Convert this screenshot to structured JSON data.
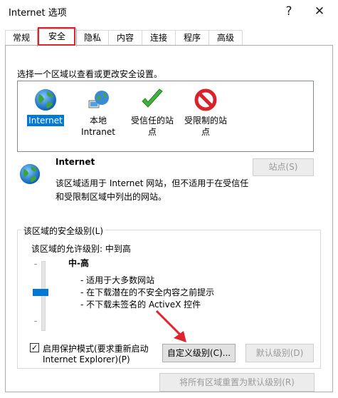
{
  "window": {
    "title": "Internet 选项",
    "help_glyph": "?",
    "close_glyph": "✕"
  },
  "tabs": [
    {
      "label": "常规"
    },
    {
      "label": "安全"
    },
    {
      "label": "隐私"
    },
    {
      "label": "内容"
    },
    {
      "label": "连接"
    },
    {
      "label": "程序"
    },
    {
      "label": "高级"
    }
  ],
  "active_tab": "安全",
  "instruction": "选择一个区域以查看或更改安全设置。",
  "zones": [
    {
      "label": "Internet",
      "icon": "globe-icon",
      "selected": true
    },
    {
      "label_lines": [
        "本地",
        "Intranet"
      ],
      "icon": "intranet-icon"
    },
    {
      "label_lines": [
        "受信任的站",
        "点"
      ],
      "icon": "checkmark-icon"
    },
    {
      "label_lines": [
        "受限制的站",
        "点"
      ],
      "icon": "restricted-icon"
    }
  ],
  "zone_info": {
    "name": "Internet",
    "desc_line1": "该区域适用于 Internet 网站，但不适用于在受信任",
    "desc_line2": "和受限制区域中列出的网站。",
    "sites_button": "站点(S)"
  },
  "security_level": {
    "group_title": "该区域的安全级别(L)",
    "allowed": "该区域的允许级别: 中到高",
    "level": "中-高",
    "bullets": [
      "- 适用于大多数网站",
      "- 在下载潜在的不安全内容之前提示",
      "- 不下载未签名的 ActiveX 控件"
    ],
    "slider_level": "中-高",
    "protected_mode_line1": "启用保护模式(要求重新启动",
    "protected_mode_line2": "Internet Explorer)(P)",
    "protected_mode_checked": true,
    "checkmark_glyph": "✓",
    "custom_button": "自定义级别(C)...",
    "default_button": "默认级别(D)"
  },
  "reset_all_button": "将所有区域重置为默认级别(R)",
  "colors": {
    "accent": "#0078d7",
    "highlight_box": "#e0242f",
    "arrow": "#e0242f"
  }
}
